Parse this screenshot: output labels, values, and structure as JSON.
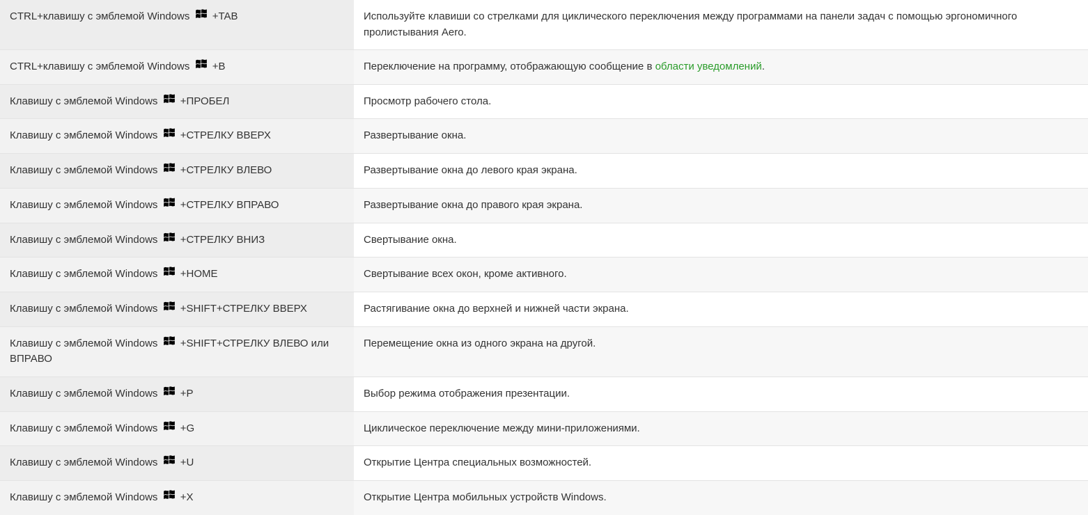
{
  "rows": [
    {
      "key_prefix": "CTRL+клавишу с эмблемой Windows",
      "key_suffix": "+TAB",
      "desc_before": "Используйте клавиши со стрелками для циклического переключения между программами на панели задач с помощью эргономичного пролистывания Aero.",
      "link_text": "",
      "desc_after": ""
    },
    {
      "key_prefix": "CTRL+клавишу с эмблемой Windows",
      "key_suffix": "+B",
      "desc_before": "Переключение на программу, отображающую сообщение в ",
      "link_text": "области уведомлений",
      "desc_after": "."
    },
    {
      "key_prefix": "Клавишу с эмблемой Windows",
      "key_suffix": "+ПРОБЕЛ",
      "desc_before": "Просмотр рабочего стола.",
      "link_text": "",
      "desc_after": ""
    },
    {
      "key_prefix": "Клавишу с эмблемой Windows",
      "key_suffix": "+СТРЕЛКУ ВВЕРХ",
      "desc_before": "Развертывание окна.",
      "link_text": "",
      "desc_after": ""
    },
    {
      "key_prefix": "Клавишу с эмблемой Windows",
      "key_suffix": "+СТРЕЛКУ ВЛЕВО",
      "desc_before": "Развертывание окна до левого края экрана.",
      "link_text": "",
      "desc_after": ""
    },
    {
      "key_prefix": "Клавишу с эмблемой Windows",
      "key_suffix": "+СТРЕЛКУ ВПРАВО",
      "desc_before": "Развертывание окна до правого края экрана.",
      "link_text": "",
      "desc_after": ""
    },
    {
      "key_prefix": "Клавишу с эмблемой Windows",
      "key_suffix": "+СТРЕЛКУ ВНИЗ",
      "desc_before": "Свертывание окна.",
      "link_text": "",
      "desc_after": ""
    },
    {
      "key_prefix": "Клавишу с эмблемой Windows",
      "key_suffix": "+HOME",
      "desc_before": "Свертывание всех окон, кроме активного.",
      "link_text": "",
      "desc_after": ""
    },
    {
      "key_prefix": "Клавишу с эмблемой Windows",
      "key_suffix": "+SHIFT+СТРЕЛКУ ВВЕРХ",
      "desc_before": "Растягивание окна до верхней и нижней части экрана.",
      "link_text": "",
      "desc_after": ""
    },
    {
      "key_prefix": "Клавишу с эмблемой Windows",
      "key_suffix": "+SHIFT+СТРЕЛКУ ВЛЕВО или ВПРАВО",
      "desc_before": "Перемещение окна из одного экрана на другой.",
      "link_text": "",
      "desc_after": ""
    },
    {
      "key_prefix": "Клавишу с эмблемой Windows",
      "key_suffix": "+P",
      "desc_before": "Выбор режима отображения презентации.",
      "link_text": "",
      "desc_after": ""
    },
    {
      "key_prefix": "Клавишу с эмблемой Windows",
      "key_suffix": "+G",
      "desc_before": "Циклическое переключение между мини-приложениями.",
      "link_text": "",
      "desc_after": ""
    },
    {
      "key_prefix": "Клавишу с эмблемой Windows",
      "key_suffix": "+U",
      "desc_before": "Открытие Центра специальных возможностей.",
      "link_text": "",
      "desc_after": ""
    },
    {
      "key_prefix": "Клавишу с эмблемой Windows",
      "key_suffix": "+X",
      "desc_before": "Открытие Центра мобильных устройств Windows.",
      "link_text": "",
      "desc_after": ""
    }
  ]
}
